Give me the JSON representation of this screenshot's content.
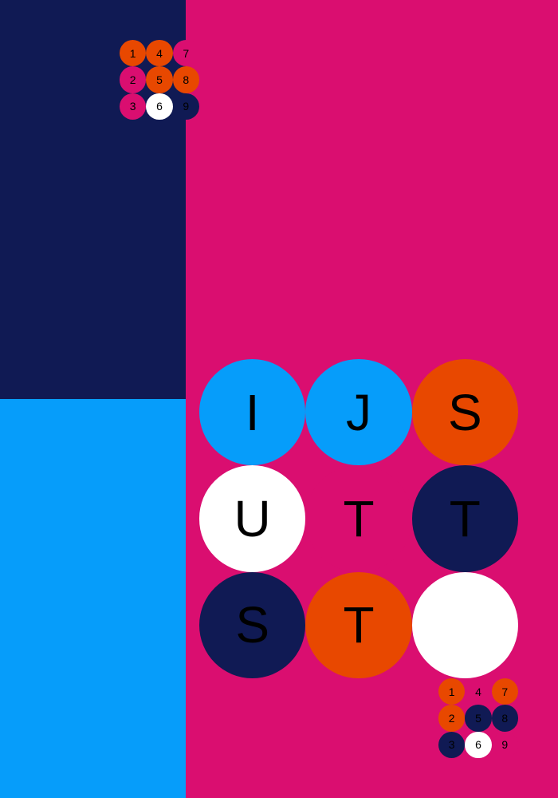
{
  "colors": {
    "background": "#da0e70",
    "navy": "#101a54",
    "sky": "#069dfa",
    "magenta": "#da0e70",
    "orange": "#e84800",
    "white": "#ffffff"
  },
  "panels": {
    "top_left": {
      "color": "#101a54"
    },
    "bottom_left": {
      "color": "#069dfa"
    },
    "right": {
      "color": "#da0e70"
    }
  },
  "main_grid": {
    "cells": [
      {
        "letter": "I",
        "color": "#069dfa"
      },
      {
        "letter": "J",
        "color": "#069dfa"
      },
      {
        "letter": "S",
        "color": "#e84800"
      },
      {
        "letter": "U",
        "color": "#ffffff"
      },
      {
        "letter": "T",
        "color": "#da0e70"
      },
      {
        "letter": "T",
        "color": "#101a54"
      },
      {
        "letter": "S",
        "color": "#101a54"
      },
      {
        "letter": "T",
        "color": "#e84800"
      },
      {
        "letter": "",
        "color": "#ffffff"
      }
    ]
  },
  "mini_grid_top": {
    "cells": [
      {
        "label": "1",
        "color": "#e84800"
      },
      {
        "label": "4",
        "color": "#e84800"
      },
      {
        "label": "7",
        "color": "#da0e70"
      },
      {
        "label": "2",
        "color": "#da0e70"
      },
      {
        "label": "5",
        "color": "#e84800"
      },
      {
        "label": "8",
        "color": "#e84800"
      },
      {
        "label": "3",
        "color": "#da0e70"
      },
      {
        "label": "6",
        "color": "#ffffff"
      },
      {
        "label": "9",
        "color": "#101a54"
      }
    ]
  },
  "mini_grid_bottom": {
    "cells": [
      {
        "label": "1",
        "color": "#e84800"
      },
      {
        "label": "4",
        "color": "#da0e70"
      },
      {
        "label": "7",
        "color": "#e84800"
      },
      {
        "label": "2",
        "color": "#e84800"
      },
      {
        "label": "5",
        "color": "#101a54"
      },
      {
        "label": "8",
        "color": "#101a54"
      },
      {
        "label": "3",
        "color": "#101a54"
      },
      {
        "label": "6",
        "color": "#ffffff"
      },
      {
        "label": "9",
        "color": "#da0e70"
      }
    ]
  }
}
